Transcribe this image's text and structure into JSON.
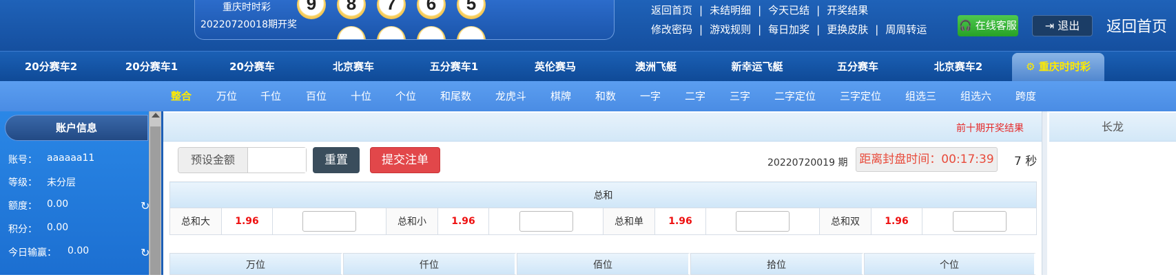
{
  "header": {
    "lottery_name": "重庆时时彩",
    "issue_text": "20220720018期开奖",
    "balls": [
      "9",
      "8",
      "7",
      "6",
      "5"
    ],
    "links_row1": [
      "返回首页",
      "未结明细",
      "今天已结",
      "开奖结果"
    ],
    "links_row2": [
      "修改密码",
      "游戏规则",
      "每日加奖",
      "更换皮肤",
      "周周转运"
    ],
    "service_button": "在线客服",
    "logout_button": "退出",
    "back_home": "返回首页"
  },
  "game_nav": {
    "tabs": [
      "20分赛车2",
      "20分赛车1",
      "20分赛车",
      "北京赛车",
      "五分赛车1",
      "英伦赛马",
      "澳洲飞艇",
      "新幸运飞艇",
      "五分赛车",
      "北京赛车2",
      "重庆时时彩"
    ],
    "active": "重庆时时彩"
  },
  "sub_nav": {
    "tabs": [
      "整合",
      "万位",
      "千位",
      "百位",
      "十位",
      "个位",
      "和尾数",
      "龙虎斗",
      "棋牌",
      "和数",
      "一字",
      "二字",
      "三字",
      "二字定位",
      "三字定位",
      "组选三",
      "组选六",
      "跨度"
    ],
    "active": "整合"
  },
  "sidebar": {
    "title": "账户信息",
    "rows": [
      {
        "label": "账号：",
        "value": "aaaaaa11"
      },
      {
        "label": "等级：",
        "value": "未分层"
      },
      {
        "label": "额度：",
        "value": "0.00"
      },
      {
        "label": "积分：",
        "value": "0.00"
      },
      {
        "label": "今日输赢：",
        "value": "0.00"
      }
    ]
  },
  "main": {
    "prev_results_link": "前十期开奖结果",
    "preset_amount_label": "预设金额",
    "preset_amount_value": "",
    "reset_button": "重置",
    "submit_button": "提交注单",
    "issue_number": "20220720019",
    "issue_suffix": "期",
    "countdown": "距离封盘时间：00:17:39",
    "seconds": "7 秒",
    "sum_table": {
      "title": "总和",
      "items": [
        {
          "name": "总和大",
          "odds": "1.96"
        },
        {
          "name": "总和小",
          "odds": "1.96"
        },
        {
          "name": "总和单",
          "odds": "1.96"
        },
        {
          "name": "总和双",
          "odds": "1.96"
        }
      ]
    },
    "position_headers": [
      "万位",
      "仟位",
      "佰位",
      "拾位",
      "个位"
    ]
  },
  "right_panel": {
    "title": "长龙"
  },
  "colors": {
    "header_blue": "#1b5aae",
    "subnav_blue": "#4a8ce4",
    "active_yellow": "#ffea00",
    "odds_red": "#e11111",
    "submit_red": "#e2474a",
    "service_green": "#27a227"
  }
}
